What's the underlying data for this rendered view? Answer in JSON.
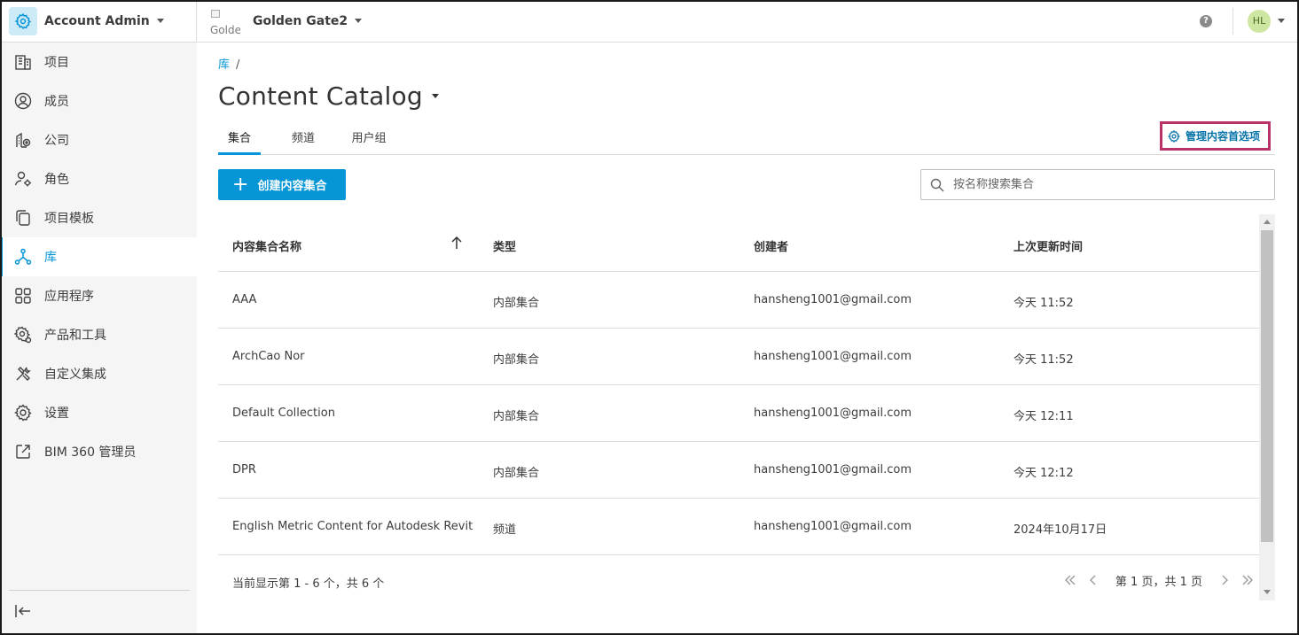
{
  "header": {
    "app_title": "Account Admin",
    "project_thumb_alt": "Golde",
    "project_name": "Golden Gate2",
    "avatar_initials": "HL"
  },
  "sidebar": {
    "items": [
      {
        "label": "项目",
        "icon": "building-icon"
      },
      {
        "label": "成员",
        "icon": "user-circle-icon"
      },
      {
        "label": "公司",
        "icon": "company-icon"
      },
      {
        "label": "角色",
        "icon": "user-gear-icon"
      },
      {
        "label": "项目模板",
        "icon": "copy-icon"
      },
      {
        "label": "库",
        "icon": "network-icon",
        "active": true
      },
      {
        "label": "应用程序",
        "icon": "apps-grid-icon"
      },
      {
        "label": "产品和工具",
        "icon": "gear-badge-icon"
      },
      {
        "label": "自定义集成",
        "icon": "hammer-wrench-icon"
      },
      {
        "label": "设置",
        "icon": "gear-icon"
      },
      {
        "label": "BIM 360 管理员",
        "icon": "external-link-icon"
      }
    ]
  },
  "breadcrumb": {
    "crumb": "库",
    "separator": "/"
  },
  "page": {
    "title": "Content Catalog"
  },
  "tabs": [
    {
      "label": "集合",
      "active": true
    },
    {
      "label": "频道",
      "active": false
    },
    {
      "label": "用户组",
      "active": false
    }
  ],
  "actions": {
    "manage_label": "管理内容首选项",
    "create_label": "创建内容集合",
    "search_placeholder": "按名称搜索集合"
  },
  "table": {
    "columns": [
      "内容集合名称",
      "类型",
      "创建者",
      "上次更新时间"
    ],
    "rows": [
      {
        "name": "AAA",
        "type": "内部集合",
        "creator": "hansheng1001@gmail.com",
        "updated": "今天 11:52"
      },
      {
        "name": "ArchCao Nor",
        "type": "内部集合",
        "creator": "hansheng1001@gmail.com",
        "updated": "今天 11:52"
      },
      {
        "name": "Default Collection",
        "type": "内部集合",
        "creator": "hansheng1001@gmail.com",
        "updated": "今天 12:11"
      },
      {
        "name": "DPR",
        "type": "内部集合",
        "creator": "hansheng1001@gmail.com",
        "updated": "今天 12:12"
      },
      {
        "name": "English Metric Content for Autodesk Revit",
        "type": "频道",
        "creator": "hansheng1001@gmail.com",
        "updated": "2024年10月17日"
      }
    ]
  },
  "footer": {
    "status": "当前显示第 1 - 6 个，共 6 个",
    "page_text": "第 1 页，共 1 页"
  },
  "colors": {
    "accent": "#0696d7",
    "highlight_border": "#b8336a",
    "sidebar_bg": "#f5f5f5"
  }
}
